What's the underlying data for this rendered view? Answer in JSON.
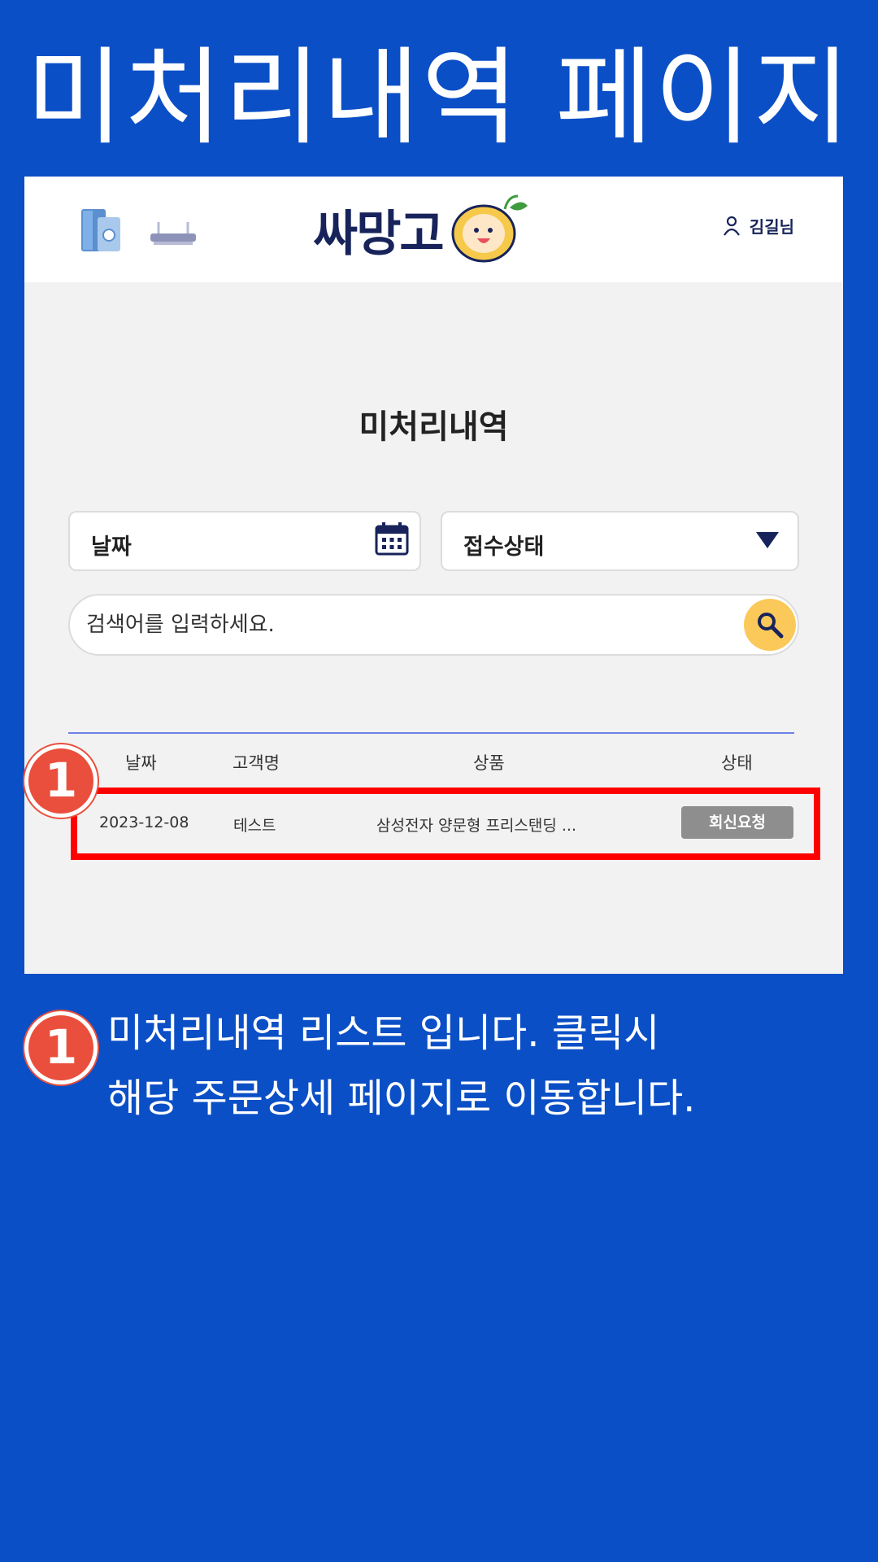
{
  "page_title": "미처리내역 페이지",
  "app": {
    "logo_text": "싸망고",
    "user_name": "김길님",
    "icons": {
      "fridge": "refrigerator-icon",
      "router": "router-icon",
      "user": "user-icon",
      "calendar": "calendar-icon",
      "dropdown": "dropdown-arrow-icon",
      "search": "search-icon"
    },
    "main_title": "미처리내역",
    "filters": {
      "date_label": "날짜",
      "status_label": "접수상태"
    },
    "search": {
      "placeholder": "검색어를 입력하세요."
    },
    "table": {
      "headers": [
        "날짜",
        "고객명",
        "상품",
        "상태"
      ],
      "rows": [
        {
          "date": "2023-12-08",
          "customer": "테스트",
          "product": "삼성전자 양문형 프리스탠딩 ...",
          "status": "회신요청"
        }
      ]
    }
  },
  "annotations": {
    "marker_number": "1",
    "description_line1": "미처리내역 리스트 입니다. 클릭시",
    "description_line2": "해당 주문상세 페이지로 이동합니다."
  },
  "colors": {
    "background": "#0b4fc6",
    "highlight": "#ff0000",
    "marker": "#e94f3c",
    "search_button": "#fbc95a",
    "badge": "#8e8e8e",
    "brand_text": "#17235a"
  }
}
